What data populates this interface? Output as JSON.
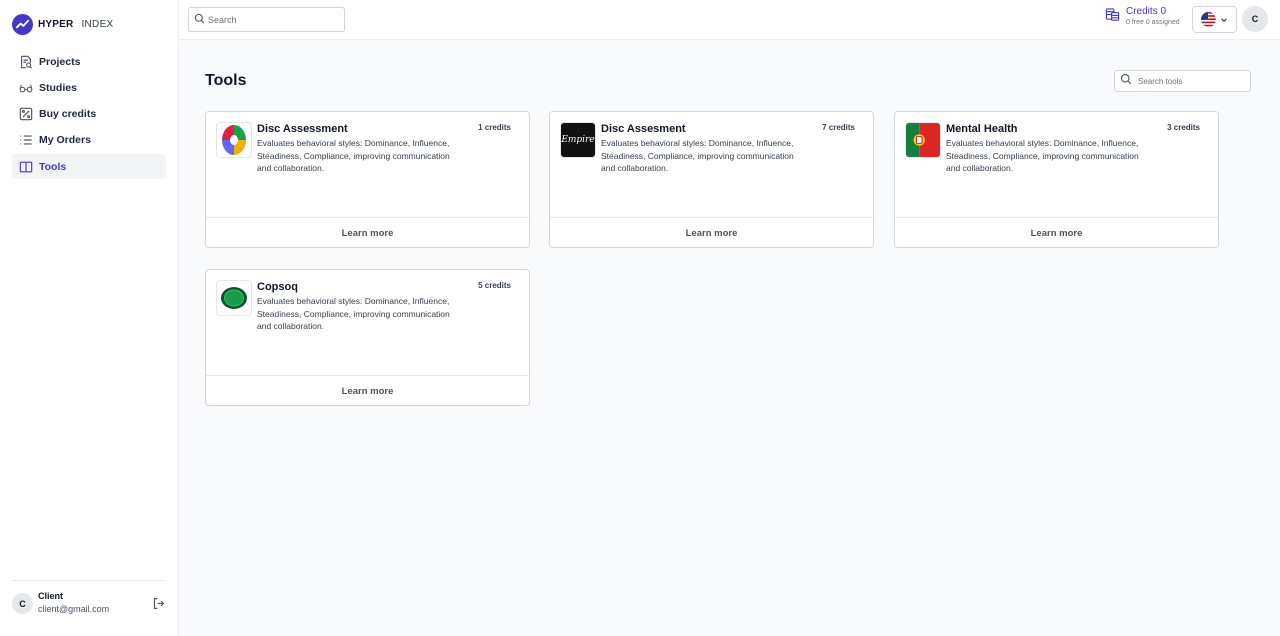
{
  "brand": {
    "name_bold": "HYPER",
    "name_light": "INDEX",
    "accent": "#4338ca"
  },
  "sidebar": {
    "items": [
      {
        "label": "Projects",
        "icon": "document-search-icon"
      },
      {
        "label": "Studies",
        "icon": "glasses-icon"
      },
      {
        "label": "Buy credits",
        "icon": "percent-icon"
      },
      {
        "label": "My Orders",
        "icon": "list-icon"
      },
      {
        "label": "Tools",
        "icon": "book-open-icon",
        "active": true
      }
    ],
    "user": {
      "initial": "C",
      "name": "Client",
      "email": "client@gmail.com"
    }
  },
  "topbar": {
    "search_placeholder": "Search",
    "credits_label": "Credits 0",
    "credits_sub": "0 free 0 assigned",
    "language": "en-US",
    "avatar_initial": "C"
  },
  "main": {
    "title": "Tools",
    "search_placeholder": "Search tools",
    "cards": [
      {
        "title": "Disc Assessment",
        "credits": "1 credits",
        "desc": "Evaluates behavioral styles: Dominance, Influence, Steadiness, Compliance, improving communication and collaboration.",
        "cta": "Learn more",
        "image": "disc-wheel"
      },
      {
        "title": "Disc Assesment",
        "credits": "7 credits",
        "desc": "Evaluates behavioral styles: Dominance, Influence, Steadiness, Compliance, improving communication and collaboration.",
        "cta": "Learn more",
        "image": "empire-logo",
        "image_text": "Empire"
      },
      {
        "title": "Mental Health",
        "credits": "3 credits",
        "desc": "Evaluates behavioral styles: Dominance, Influence, Steadiness, Compliance, improving communication and collaboration.",
        "cta": "Learn more",
        "image": "portugal-flag"
      },
      {
        "title": "Copsoq",
        "credits": "5 credits",
        "desc": "Evaluates behavioral styles: Dominance, Influence, Steadiness, Compliance, improving communication and collaboration.",
        "cta": "Learn more",
        "image": "green-oval"
      }
    ]
  }
}
